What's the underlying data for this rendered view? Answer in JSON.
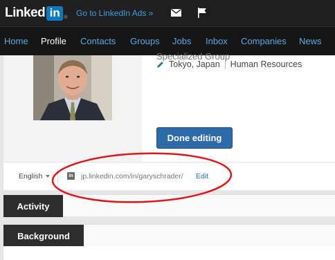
{
  "header": {
    "logo_text": "Linked",
    "logo_box": "in",
    "logo_reg": "®",
    "ads_link": "Go to LinkedIn Ads »",
    "icons": [
      "mail-icon",
      "flag-icon"
    ]
  },
  "nav": {
    "items": [
      "Home",
      "Profile",
      "Contacts",
      "Groups",
      "Jobs",
      "Inbox",
      "Companies",
      "News"
    ],
    "active": "Profile"
  },
  "profile": {
    "cutoff_text": "Specialized Group",
    "location": "Tokyo, Japan",
    "industry": "Human Resources",
    "done_button": "Done editing"
  },
  "footer": {
    "language": "English",
    "url": "jp.linkedin.com/in/garyschrader/",
    "edit_label": "Edit"
  },
  "sections": {
    "activity": "Activity",
    "background": "Background"
  },
  "colors": {
    "brand_blue": "#0a7bc2",
    "nav_link": "#5aa9e8",
    "button_blue": "#2c6aa8",
    "annotation_red": "#e0161a"
  }
}
